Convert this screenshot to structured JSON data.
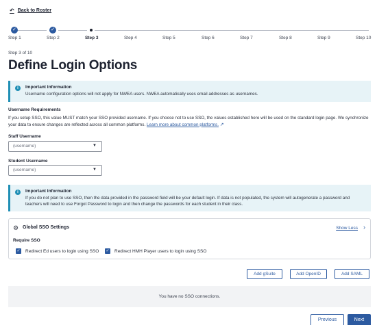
{
  "nav": {
    "back_label": "Back to Roster"
  },
  "stepper": {
    "steps": [
      {
        "label": "Step 1",
        "state": "done"
      },
      {
        "label": "Step 2",
        "state": "done"
      },
      {
        "label": "Step 3",
        "state": "current"
      },
      {
        "label": "Step 4",
        "state": "future"
      },
      {
        "label": "Step 5",
        "state": "future"
      },
      {
        "label": "Step 6",
        "state": "future"
      },
      {
        "label": "Step 7",
        "state": "future"
      },
      {
        "label": "Step 8",
        "state": "future"
      },
      {
        "label": "Step 9",
        "state": "future"
      },
      {
        "label": "Step 10",
        "state": "future"
      }
    ]
  },
  "page": {
    "step_count": "Step 3 of 10",
    "title": "Define Login Options"
  },
  "info1": {
    "title": "Important Information",
    "text": "Username configuration options will not apply for NWEA users. NWEA automatically uses email addresses as usernames."
  },
  "requirements": {
    "title": "Username Requirements",
    "text": "If you setup SSO, this value MUST match your SSO provided username. If you choose not to use SSO, the values established here will be used on the standard login page. We synchronize your data to ensure changes are reflected across all common platforms.",
    "link": "Learn more about common platforms."
  },
  "staff": {
    "label": "Staff Username",
    "value": "(username)"
  },
  "student": {
    "label": "Student Username",
    "value": "(username)"
  },
  "info2": {
    "title": "Important Information",
    "text": "If you do not plan to use SSO, then the data provided in the password field will be your default login. If data is not populated, the system will autogenerate a password and teachers will need to use Forgot Password to login and then change the passwords for each student in their class."
  },
  "sso": {
    "title": "Global SSO Settings",
    "toggle_label": "Show Less",
    "require_label": "Require SSO",
    "checkboxes": [
      {
        "label": "Redirect Ed users to login using SSO",
        "checked": true
      },
      {
        "label": "Redirect HMH Player users to login using SSO",
        "checked": true
      }
    ]
  },
  "buttons": {
    "add_gsuite": "Add gSuite",
    "add_openid": "Add OpenID",
    "add_saml": "Add SAML",
    "previous": "Previous",
    "next": "Next"
  },
  "empty_state": "You have no SSO connections.",
  "colors": {
    "accent": "#2c5aa0",
    "info": "#1f8fb5",
    "info_bg": "#e7f3f7"
  }
}
